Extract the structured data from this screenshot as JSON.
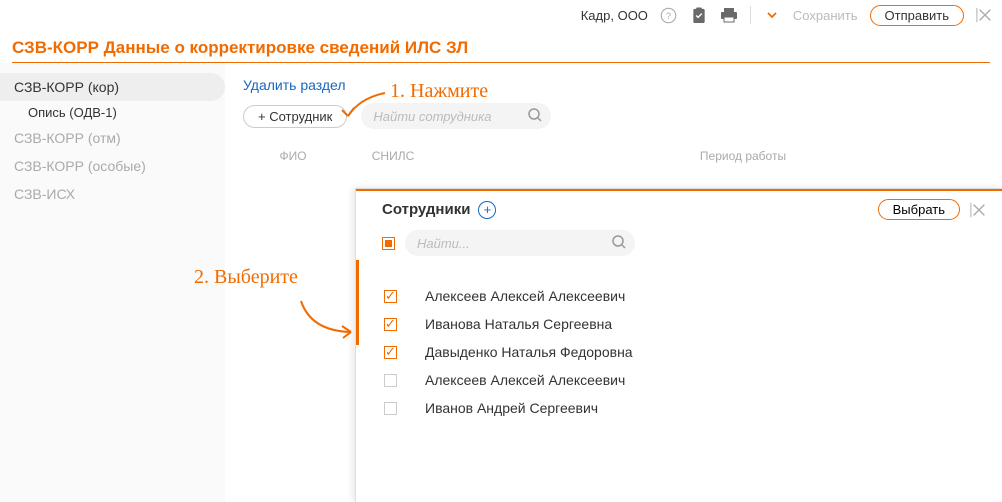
{
  "topbar": {
    "org": "Кадр, ООО",
    "save": "Сохранить",
    "send": "Отправить"
  },
  "title": "СЗВ-КОРР Данные о корректировке сведений ИЛС ЗЛ",
  "sidebar": {
    "items": [
      "СЗВ-КОРР (кор)",
      "СЗВ-КОРР (отм)",
      "СЗВ-КОРР (особые)",
      "СЗВ-ИСХ"
    ],
    "sub": "Опись (ОДВ-1)"
  },
  "main": {
    "delete_section": "Удалить раздел",
    "add_employee": "+ Сотрудник",
    "search_ph": "Найти сотрудника",
    "col_fio": "ФИО",
    "col_snils": "СНИЛС",
    "col_period": "Период работы"
  },
  "annotations": {
    "a1": "1. Нажмите",
    "a2": "2. Выберите"
  },
  "panel": {
    "title": "Сотрудники",
    "choose": "Выбрать",
    "search_ph": "Найти...",
    "employees": [
      {
        "name": "Алексеев Алексей Алексеевич",
        "checked": true
      },
      {
        "name": "Иванова Наталья Сергеевна",
        "checked": true
      },
      {
        "name": "Давыденко Наталья Федоровна",
        "checked": true
      },
      {
        "name": "Алексеев Алексей Алексеевич",
        "checked": false
      },
      {
        "name": "Иванов Андрей Сергеевич",
        "checked": false
      }
    ]
  }
}
